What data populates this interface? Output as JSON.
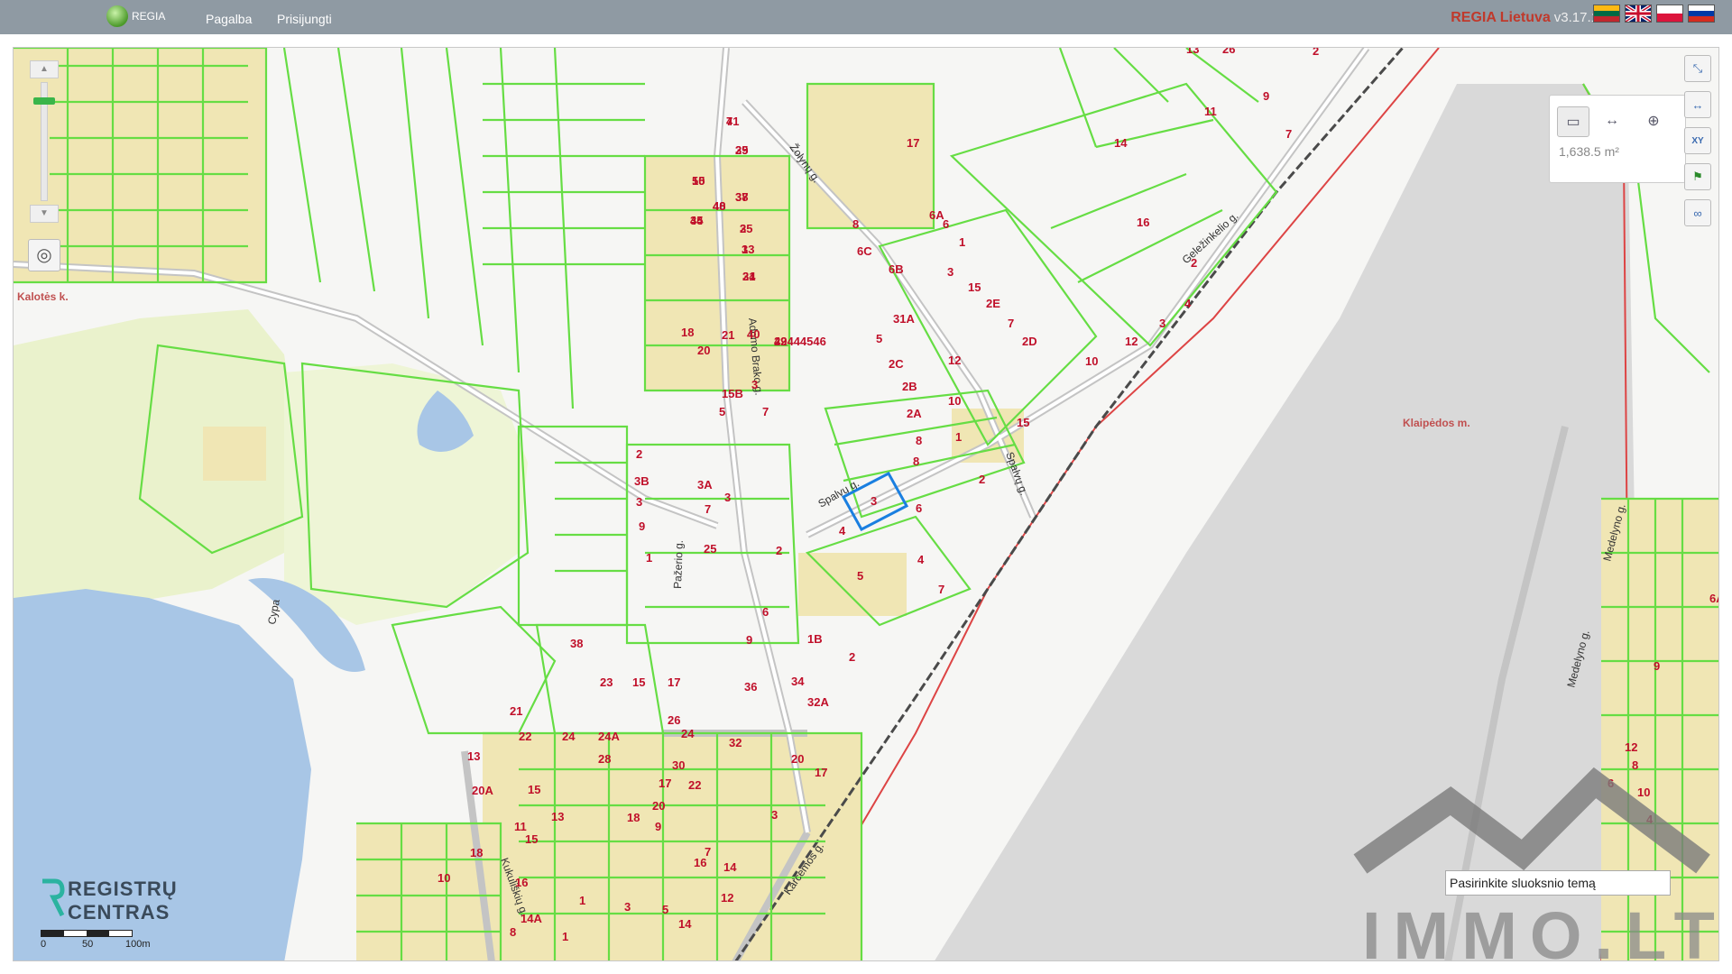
{
  "header": {
    "logo_text": "REGIA",
    "nav": [
      "Pagalba",
      "Prisijungti"
    ],
    "brand": "REGIA Lietuva",
    "version": "v3.17.1",
    "flags": [
      "lithuanian-flag",
      "english-flag",
      "polish-flag",
      "russian-flag"
    ]
  },
  "tools": {
    "area_value": "1,638.5 m²",
    "active_tool": "parcel-measure-icon",
    "icons": [
      "parcel-measure-icon",
      "distance-measure-icon",
      "globe-icon"
    ],
    "right_icons": [
      "fullscreen-icon",
      "measure-icon",
      "xy-coordinates-icon",
      "flag-icon",
      "link-icon"
    ],
    "xy_label": "XY"
  },
  "map": {
    "places": [
      "Kalotės k.",
      "Klaipėdos m."
    ],
    "streets": [
      "Žolynų g.",
      "Geležinkelio g.",
      "Adomo Brako g.",
      "Spalvų g.",
      "Pažerio g.",
      "Karčemos g.",
      "Kukuliškių g.",
      "Medelyno g.",
      "Cypa"
    ],
    "parcel_labels": [
      "41",
      "39",
      "50",
      "48",
      "37",
      "45",
      "35",
      "33",
      "31",
      "29",
      "17",
      "8",
      "6C",
      "6B",
      "31A",
      "6A",
      "6",
      "1",
      "3",
      "15",
      "2E",
      "7",
      "2D",
      "5",
      "2C",
      "2B",
      "2A",
      "8",
      "10",
      "12",
      "14",
      "16",
      "2",
      "4",
      "3",
      "12",
      "10",
      "15",
      "13",
      "11",
      "9",
      "7",
      "2",
      "26",
      "18",
      "20",
      "21",
      "40",
      "15B",
      "5",
      "3",
      "7",
      "1",
      "8",
      "2",
      "6",
      "4",
      "2",
      "3B",
      "3A",
      "3",
      "7",
      "9",
      "25",
      "1",
      "3",
      "2",
      "5",
      "4",
      "7",
      "6",
      "9",
      "1B",
      "2",
      "38",
      "23",
      "15",
      "17",
      "36",
      "34",
      "32A",
      "21",
      "22",
      "24",
      "24A",
      "26",
      "24",
      "28",
      "32",
      "30",
      "20",
      "17",
      "13",
      "15",
      "17",
      "20",
      "22",
      "20A",
      "11",
      "13",
      "15",
      "18",
      "18",
      "9",
      "7",
      "3",
      "16",
      "14",
      "12",
      "10",
      "16",
      "1",
      "5",
      "3",
      "14",
      "14A",
      "1",
      "8",
      "12",
      "8",
      "10",
      "6",
      "4",
      "6A",
      "9",
      "7",
      "25",
      "15",
      "40",
      "38",
      "34",
      "2",
      "1",
      "24",
      "42444546"
    ]
  },
  "selected_parcel_label": "3",
  "scale": {
    "labels": [
      "0",
      "50",
      "100m"
    ]
  },
  "registry_logo": [
    "REGISTRŲ",
    "CENTRAS"
  ],
  "layer_input": {
    "value": "Pasirinkite sluoksnio temą"
  },
  "watermark": "IMMO.LT",
  "colors": {
    "topbar": "#8f9aa3",
    "parcel_border": "#66dd44",
    "built_area": "#f0e6b4",
    "water": "#a8c6e6",
    "road": "#c4c4c4",
    "rail": "#4a4a4a",
    "city_boundary": "#d44",
    "selection": "#1a7fe0",
    "labels": "#c0102a"
  }
}
